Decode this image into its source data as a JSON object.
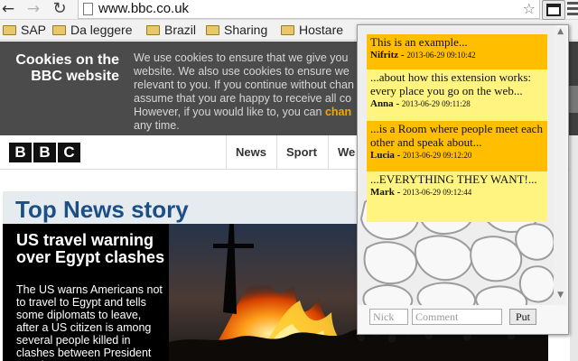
{
  "browser": {
    "url": "www.bbc.co.uk",
    "bookmarks": [
      "SAP",
      "Da leggere",
      "Brazil",
      "Sharing",
      "Hostare"
    ]
  },
  "cookie_banner": {
    "title_line1": "Cookies on the",
    "title_line2": "BBC website",
    "line1": "We use cookies to ensure that we give you",
    "line2": "website. We also use cookies to ensure we",
    "line3": "relevant to you. If you continue without chan",
    "line4": "assume that you are happy to receive all co",
    "line5": "However, if you would like to, you can",
    "link": "chan",
    "line6": "any time."
  },
  "bbc_nav": {
    "logo": [
      "B",
      "B",
      "C"
    ],
    "links": [
      "News",
      "Sport",
      "We"
    ]
  },
  "content": {
    "section_title": "Top News story",
    "headline": "US travel warning over Egypt clashes",
    "summary": "The US warns Americans not to travel to Egypt and tells some diplomats to leave, after a US citizen is among several people killed in clashes between President Morsi's"
  },
  "chat": {
    "messages": [
      {
        "text": "This is an example...",
        "user": "Nifritz",
        "date": "2013-06-29 09:10:42",
        "style": "orange"
      },
      {
        "text": "...about how this extension works: every place you go on the web...",
        "user": "Anna",
        "date": "2013-06-29 09:11:28",
        "style": "yellow"
      },
      {
        "text": "...is a Room where people meet each other and speak about...",
        "user": "Lucia",
        "date": "2013-06-29 09:12:20",
        "style": "orange"
      },
      {
        "text": "...EVERYTHING THEY WANT!...",
        "user": "Mark",
        "date": "2013-06-29 09:12:44",
        "style": "yellow"
      }
    ],
    "nick_placeholder": "Nick",
    "comment_placeholder": "Comment",
    "put_label": "Put"
  },
  "colors": {
    "bbc_blue": "#1c4f86",
    "orange_message": "#ffbf00",
    "yellow_message": "#fff47f",
    "cookie_link": "#f3a800"
  }
}
